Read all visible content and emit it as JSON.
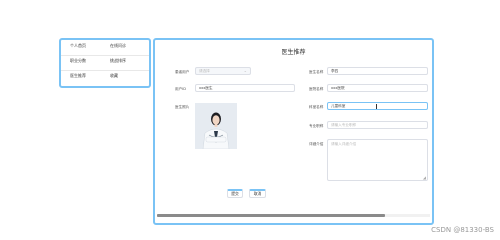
{
  "menu": {
    "items": [
      [
        "个人首页",
        "在线问诊"
      ],
      [
        "职业分数",
        "挑战排序"
      ],
      [
        "医生推荐",
        "收藏"
      ]
    ]
  },
  "form": {
    "title": "医生推荐",
    "left": {
      "category_label": "患者用户",
      "category_placeholder": "请选择",
      "username_label": "用户ID",
      "username_value": "xxx医生",
      "photo_label": "医生照片"
    },
    "right": {
      "name_label": "医生名称",
      "name_value": "李四",
      "hospital_label": "医院名称",
      "hospital_value": "xxx医院",
      "dept_label": "科室名称",
      "dept_value": "儿童科室",
      "title_label": "专业职称",
      "title_placeholder": "请输入专业职称",
      "intro_label": "详细介绍",
      "intro_placeholder": "请输入详细介绍"
    },
    "buttons": {
      "submit": "提交",
      "cancel": "取消"
    }
  },
  "watermark": "CSDN @81330-BS"
}
